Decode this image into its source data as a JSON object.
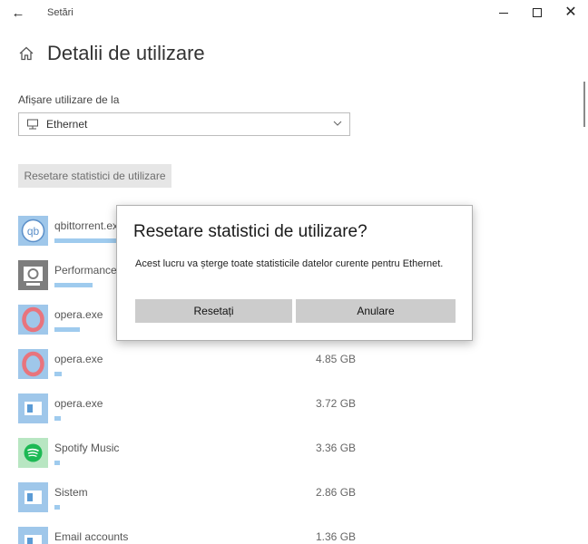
{
  "window": {
    "title": "Setări",
    "back_glyph": "←",
    "close_glyph": "✕"
  },
  "header": {
    "title": "Detalii de utilizare",
    "home_icon": "home-icon"
  },
  "usage": {
    "show_label": "Afișare utilizare de la",
    "network_value": "Ethernet",
    "reset_button": "Resetare statistici de utilizare"
  },
  "apps": [
    {
      "name": "qbittorrent.exe",
      "size": "",
      "icon": "qbittorrent-icon",
      "usage_fraction": 1.0
    },
    {
      "name": "PerformanceT",
      "size": "",
      "icon": "performance-icon",
      "usage_fraction": 0.6
    },
    {
      "name": "opera.exe",
      "size": "",
      "icon": "opera-icon",
      "usage_fraction": 0.4
    },
    {
      "name": "opera.exe",
      "size": "4.85 GB",
      "icon": "opera-icon",
      "usage_fraction": 0.12
    },
    {
      "name": "opera.exe",
      "size": "3.72 GB",
      "icon": "window-icon",
      "usage_fraction": 0.1
    },
    {
      "name": "Spotify Music",
      "size": "3.36 GB",
      "icon": "spotify-icon",
      "usage_fraction": 0.09
    },
    {
      "name": "Sistem",
      "size": "2.86 GB",
      "icon": "window-icon",
      "usage_fraction": 0.08
    },
    {
      "name": "Email accounts",
      "size": "1.36 GB",
      "icon": "window-icon",
      "usage_fraction": 0.05
    }
  ],
  "dialog": {
    "title": "Resetare statistici de utilizare?",
    "message": "Acest lucru va șterge toate statisticile datelor curente pentru Ethernet.",
    "confirm_label": "Resetați",
    "cancel_label": "Anulare"
  },
  "colors": {
    "bar": "#9fcbee",
    "opera": "#e8747d",
    "spotify": "#1db954",
    "window_icon": "#5b9bd5"
  }
}
